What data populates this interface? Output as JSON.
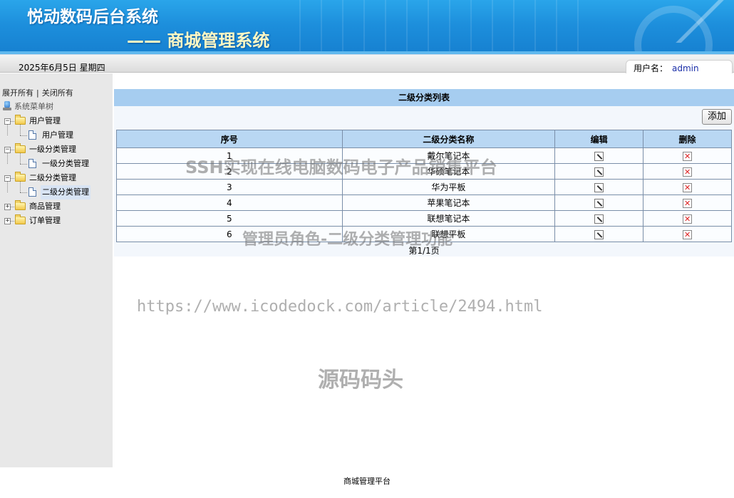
{
  "header": {
    "title": "悦动数码后台系统",
    "subtitle": "—— 商城管理系统"
  },
  "infobar": {
    "date": "2025年6月5日 星期四",
    "user_label": "用户名：",
    "username": "admin"
  },
  "sidebar": {
    "expand_all": "展开所有",
    "separator": "|",
    "collapse_all": "关闭所有",
    "root": "系统菜单树",
    "groups": [
      {
        "label": "用户管理",
        "expanded": true,
        "children": [
          {
            "label": "用户管理",
            "selected": false
          }
        ]
      },
      {
        "label": "一级分类管理",
        "expanded": true,
        "children": [
          {
            "label": "一级分类管理",
            "selected": false
          }
        ]
      },
      {
        "label": "二级分类管理",
        "expanded": true,
        "children": [
          {
            "label": "二级分类管理",
            "selected": true
          }
        ]
      },
      {
        "label": "商品管理",
        "expanded": false,
        "children": []
      },
      {
        "label": "订单管理",
        "expanded": false,
        "children": []
      }
    ]
  },
  "main": {
    "panel_title": "二级分类列表",
    "add_label": "添加",
    "columns": [
      "序号",
      "二级分类名称",
      "编辑",
      "删除"
    ],
    "rows": [
      {
        "id": "1",
        "name": "戴尔笔记本"
      },
      {
        "id": "2",
        "name": "华硕笔记本"
      },
      {
        "id": "3",
        "name": "华为平板"
      },
      {
        "id": "4",
        "name": "苹果笔记本"
      },
      {
        "id": "5",
        "name": "联想笔记本"
      },
      {
        "id": "6",
        "name": "联想平板"
      }
    ],
    "pager": "第1/1页"
  },
  "watermarks": {
    "line1": "SSH实现在线电脑数码电子产品销售平台",
    "line2": "管理员角色-二级分类管理功能",
    "line3": "https://www.icodedock.com/article/2494.html",
    "line4": "源码码头"
  },
  "footer": "商城管理平台",
  "colors": {
    "banner": "#1d8fdc",
    "header_row": "#b9d7f3",
    "panel_title": "#a6cdf0",
    "delete_icon": "#dd2222"
  }
}
